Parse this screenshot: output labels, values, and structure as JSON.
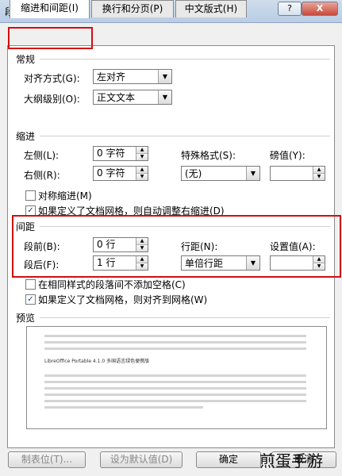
{
  "window": {
    "title": "段落",
    "help_label": "?",
    "close_label": "X"
  },
  "tabs": [
    {
      "label": "缩进和间距(I)"
    },
    {
      "label": "换行和分页(P)"
    },
    {
      "label": "中文版式(H)"
    }
  ],
  "general": {
    "heading": "常规",
    "alignment_label": "对齐方式(G):",
    "alignment_value": "左对齐",
    "outline_label": "大纲级别(O):",
    "outline_value": "正文文本"
  },
  "indent": {
    "heading": "缩进",
    "left_label": "左侧(L):",
    "left_value": "0 字符",
    "right_label": "右侧(R):",
    "right_value": "0 字符",
    "special_label": "特殊格式(S):",
    "special_value": "(无)",
    "measure_label": "磅值(Y):",
    "measure_value": "",
    "mirror_label": "对称缩进(M)",
    "auto_adjust_label": "如果定义了文档网格，则自动调整右缩进(D)"
  },
  "spacing": {
    "heading": "间距",
    "before_label": "段前(B):",
    "before_value": "0 行",
    "after_label": "段后(F):",
    "after_value": "1 行",
    "line_label": "行距(N):",
    "line_value": "单倍行距",
    "at_label": "设置值(A):",
    "at_value": "",
    "no_space_label": "在相同样式的段落间不添加空格(C)",
    "snap_grid_label": "如果定义了文档网格，则对齐到网格(W)"
  },
  "preview": {
    "heading": "预览",
    "sample_text": "LibreOffice Portable 4.1.0 多国语言绿色便携版"
  },
  "buttons": {
    "tabs_label": "制表位(T)...",
    "default_label": "设为默认值(D)",
    "ok_label": "确定",
    "cancel_label": "取消"
  },
  "watermark": "煎蛋手游"
}
